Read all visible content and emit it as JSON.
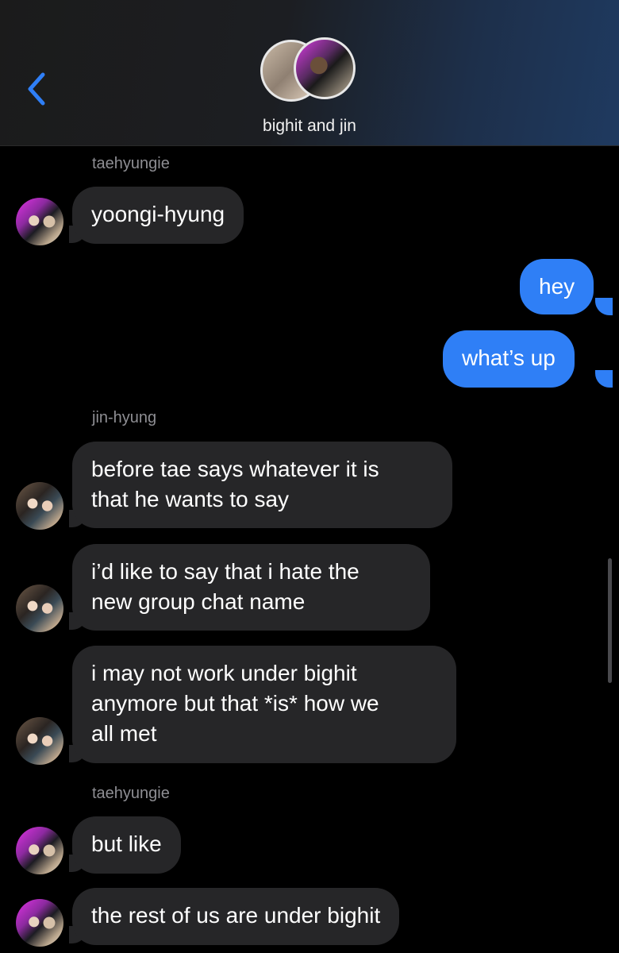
{
  "header": {
    "back_icon": "chevron-left-icon",
    "title": "bighit and jin",
    "accent_color": "#2f7ff6"
  },
  "messages": [
    {
      "type": "sender",
      "text": "taehyungie"
    },
    {
      "type": "in",
      "who": "taehyungie",
      "text": "yoongi-hyung"
    },
    {
      "type": "out",
      "text": "hey"
    },
    {
      "type": "out",
      "text": "what’s up"
    },
    {
      "type": "sender",
      "text": "jin-hyung"
    },
    {
      "type": "in",
      "who": "jin-hyung",
      "lines": [
        "before tae says whatever it is",
        "that he wants to say"
      ]
    },
    {
      "type": "in",
      "who": "jin-hyung",
      "lines": [
        "i’d like to say that i hate the",
        "new group chat name"
      ]
    },
    {
      "type": "in",
      "who": "jin-hyung",
      "lines": [
        "i may not work under bighit",
        "anymore but that *is* how we",
        "all met"
      ]
    },
    {
      "type": "sender",
      "text": "taehyungie"
    },
    {
      "type": "in",
      "who": "taehyungie",
      "text": "but like"
    },
    {
      "type": "in",
      "who": "taehyungie",
      "text": "the rest of us are under bighit"
    }
  ]
}
